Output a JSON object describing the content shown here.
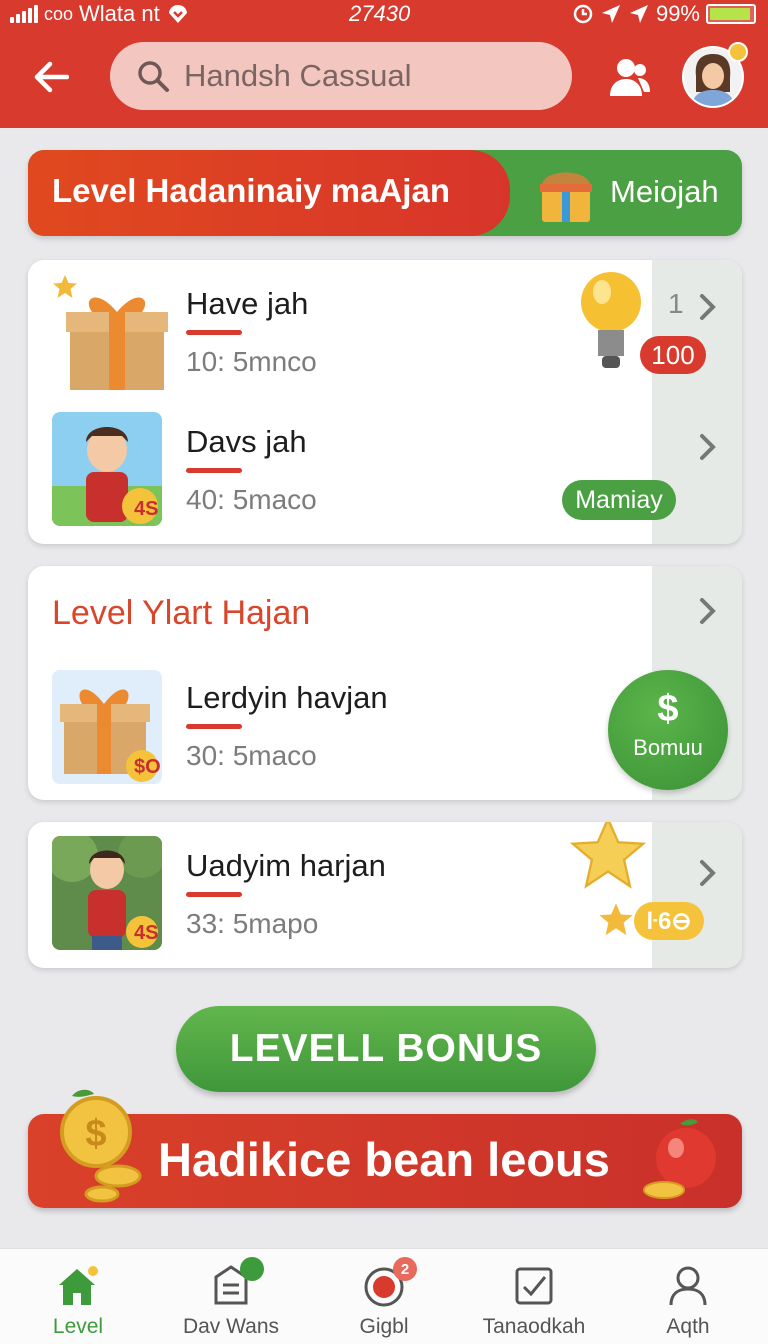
{
  "status_bar": {
    "carrier": "Wlata nt",
    "carrier_prefix": "coo",
    "time": "27430",
    "battery": "99%"
  },
  "search": {
    "placeholder": "Handsh Cassual"
  },
  "banner": {
    "title": "Level Hadaninaiy maAjan",
    "side_label": "Meiojah"
  },
  "card1": {
    "items": [
      {
        "title": "Have jah",
        "subtitle": "10: 5mnco",
        "count": "1",
        "badge": "100"
      },
      {
        "title": "Davs jah",
        "subtitle": "40: 5maco",
        "tag": "Mamiay",
        "thumb_tag": "4S"
      }
    ]
  },
  "card2": {
    "title": "Level Ylart Hajan",
    "item": {
      "title": "Lerdyin havjan",
      "subtitle": "30: 5maco",
      "thumb_tag": "$O"
    },
    "bonus_symbol": "$",
    "bonus_label": "Bomuu"
  },
  "card3": {
    "item": {
      "title": "Uadyim harjan",
      "subtitle": "33: 5mapo",
      "thumb_tag": "4S"
    },
    "points": "ŀ6⊖"
  },
  "cta": {
    "label": "LEVELL BONUS"
  },
  "promo": {
    "label": "Hadikice bean leous"
  },
  "bottom_nav": {
    "items": [
      {
        "label": "Level",
        "icon": "home-icon",
        "active": true
      },
      {
        "label": "Dav Wans",
        "icon": "calendar-icon",
        "badge": ""
      },
      {
        "label": "Gigbl",
        "icon": "record-icon",
        "badge": "2"
      },
      {
        "label": "Tanaodkah",
        "icon": "checklist-icon"
      },
      {
        "label": "Aqth",
        "icon": "user-icon"
      }
    ]
  },
  "colors": {
    "primary_red": "#d93a2e",
    "accent_green": "#3e9b3c",
    "gold": "#f5c33b"
  }
}
